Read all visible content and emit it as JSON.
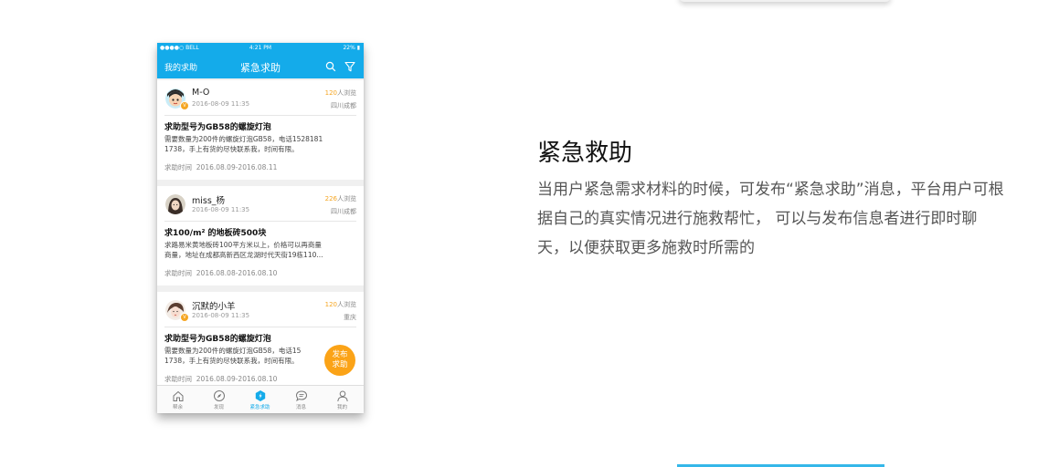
{
  "status_bar": {
    "carrier": "●●●●○ BELL",
    "time": "4:21 PM",
    "battery": "22%"
  },
  "nav": {
    "left_label": "我的求助",
    "title": "紧急求助",
    "search_icon": "search-icon",
    "filter_icon": "filter-icon"
  },
  "posts": [
    {
      "user": "M-O",
      "date": "2016-08-09  11:35",
      "views_count": "120",
      "views_suffix": "人浏览",
      "location": "四川成都",
      "title": "求助型号为GB58的螺旋灯泡",
      "desc_line1": "需要数量为200件的螺旋灯泡GB58，电话1528181",
      "desc_line2": "1738，手上有货的尽快联系我，时间有限。",
      "time_label": "求助时间",
      "time_range": "2016.08.09-2016.08.11"
    },
    {
      "user": "miss_杨",
      "date": "2016-08-09  11:35",
      "views_count": "226",
      "views_suffix": "人浏览",
      "location": "四川成都",
      "title": "求100/m² 的地板砖500块",
      "desc_line1": "求路易米黄地板砖100平方米以上，价格可以再商量",
      "desc_line2": "商量，地址在成都高新西区龙湖时代天街19栋110...",
      "time_label": "求助时间",
      "time_range": "2016.08.08-2016.08.10"
    },
    {
      "user": "沉默的小羊",
      "date": "2016-08-09  11:35",
      "views_count": "120",
      "views_suffix": "人浏览",
      "location": "重庆",
      "title": "求助型号为GB58的螺旋灯泡",
      "desc_line1": "需要数量为200件的螺旋灯泡GB58，电话15",
      "desc_line2": "1738，手上有货的尽快联系我，时间有限。",
      "time_label": "求助时间",
      "time_range": "2016.08.09-2016.08.10"
    }
  ],
  "fab": {
    "line1": "发布",
    "line2": "求助"
  },
  "tabs": [
    {
      "label": "帮余",
      "icon": "home-icon"
    },
    {
      "label": "发现",
      "icon": "compass-icon"
    },
    {
      "label": "紧急求助",
      "icon": "emergency-icon",
      "active": true
    },
    {
      "label": "消息",
      "icon": "message-icon"
    },
    {
      "label": "我的",
      "icon": "user-icon"
    }
  ],
  "feature": {
    "title": "紧急救助",
    "line1": "当用户紧急需求材料的时候，可发布“紧急求助”消息，平台用户可根",
    "line2": "据自己的真实情况进行施救帮忙， 可以与发布信息者进行即时聊",
    "line3": "天，以便获取更多施救时所需的"
  },
  "colors": {
    "accent": "#14abea",
    "highlight": "#f5a623",
    "fab": "#fba317"
  }
}
